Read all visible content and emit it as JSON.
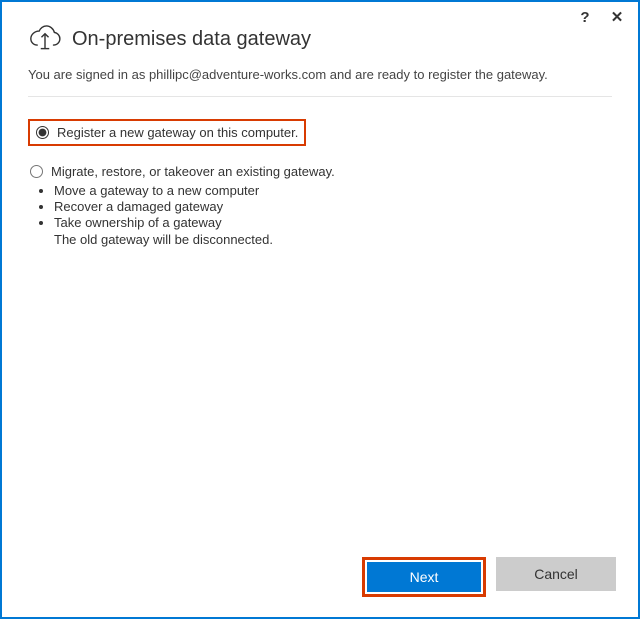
{
  "window": {
    "title": "On-premises data gateway"
  },
  "signin_text_prefix": "You are signed in as ",
  "signin_email": "phillipc@adventure-works.com",
  "signin_text_suffix": " and are ready to register the gateway.",
  "options": {
    "register": {
      "label": "Register a new gateway on this computer.",
      "selected": true
    },
    "migrate": {
      "label": "Migrate, restore, or takeover an existing gateway.",
      "selected": false,
      "bullets": [
        "Move a gateway to a new computer",
        "Recover a damaged gateway",
        "Take ownership of a gateway"
      ],
      "note": "The old gateway will be disconnected."
    }
  },
  "buttons": {
    "next": "Next",
    "cancel": "Cancel"
  },
  "titlebar": {
    "help": "?",
    "close": "✕"
  }
}
